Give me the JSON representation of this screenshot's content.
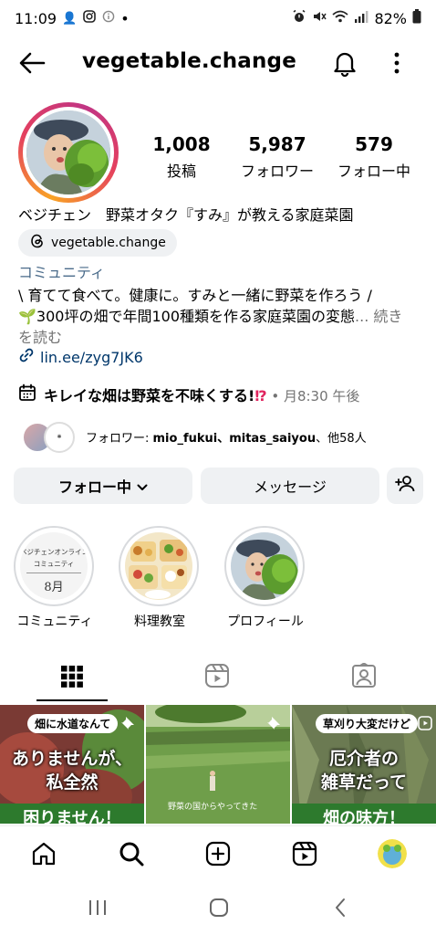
{
  "status": {
    "time": "11:09",
    "battery": "82%"
  },
  "header": {
    "username": "vegetable.change"
  },
  "stats": [
    {
      "value": "1,008",
      "label": "投稿"
    },
    {
      "value": "5,987",
      "label": "フォロワー"
    },
    {
      "value": "579",
      "label": "フォロー中"
    }
  ],
  "bio": {
    "name": "ベジチェン　野菜オタク『すみ』が教える家庭菜園",
    "threads_handle": "vegetable.change",
    "category": "コミュニティ",
    "line1": "\\ 育てて食べて。健康に。すみと一緒に野菜を作ろう /",
    "line2_text": "300坪の畑で年間100種類を作る家庭菜園の変態",
    "line2_ellipsis": "...",
    "more_label": " 続き",
    "line3_more": "を読む",
    "link": "lin.ee/zyg7JK6",
    "event_title": "キレイな畑は野菜を不味くする!",
    "event_emoji": "⁉",
    "event_time": " • 月8:30 午後",
    "followers_note_prefix": "フォロワー: ",
    "followers_note_names": "mio_fukui、mitas_saiyou",
    "followers_note_suffix": "、他58人"
  },
  "buttons": {
    "following": "フォロー中",
    "message": "メッセージ"
  },
  "highlights": [
    {
      "label": "コミュニティ",
      "cover_line1": "ベジチェンオンライン",
      "cover_line2": "コミュニティ",
      "cover_line3": "8月"
    },
    {
      "label": "料理教室"
    },
    {
      "label": "プロフィール"
    }
  ],
  "grid": [
    {
      "top_caption": "畑に水道なんて",
      "main_line1": "ありませんが、",
      "main_line2": "私全然",
      "bottom_line": "困りません！"
    },
    {
      "overlay_text": "野菜の国からやってきた"
    },
    {
      "top_caption": "草刈り大変だけど",
      "main_line1": "厄介者の",
      "main_line2": "雑草だって",
      "bottom_line": "畑の味方！"
    }
  ],
  "colors": {
    "link": "#00376b",
    "accent_blue": "#0095f6",
    "chip_bg": "#eff1f3",
    "story_gradient": [
      "#f9a325",
      "#e4405f",
      "#c13584"
    ]
  }
}
